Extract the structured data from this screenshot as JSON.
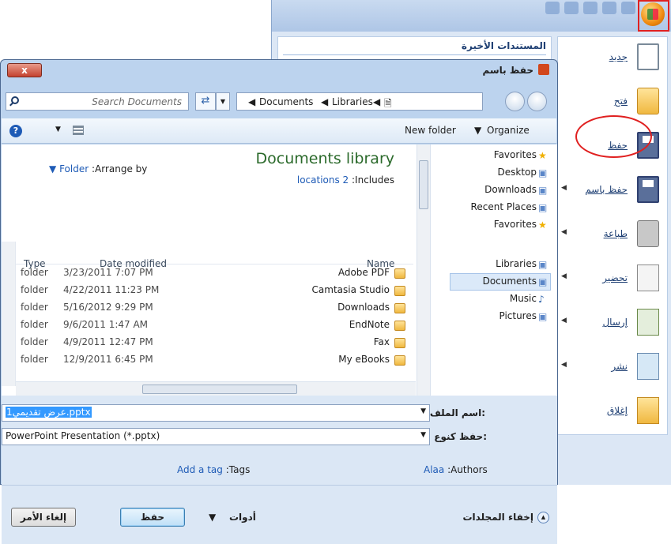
{
  "office": {
    "recent_title": "المستندات الأخيرة",
    "menu": [
      {
        "label": "جديد",
        "has_arrow": false
      },
      {
        "label": "فتح",
        "has_arrow": false
      },
      {
        "label": "حفظ",
        "has_arrow": false
      },
      {
        "label": "حفظ باسم",
        "has_arrow": true
      },
      {
        "label": "طباعة",
        "has_arrow": true
      },
      {
        "label": "تحضير",
        "has_arrow": true
      },
      {
        "label": "إرسال",
        "has_arrow": true
      },
      {
        "label": "نشر",
        "has_arrow": true
      },
      {
        "label": "إغلاق",
        "has_arrow": false
      }
    ]
  },
  "dialog": {
    "title": "حفظ باسم",
    "close": "x",
    "search_placeholder": "Search Documents",
    "breadcrumb": [
      "Libraries",
      "Documents"
    ],
    "toolbar": {
      "organize": "Organize",
      "new_folder": "New folder"
    },
    "library": {
      "title": "Documents library",
      "includes_label": ":Includes",
      "includes_link": "locations 2",
      "arrange_label": ":Arrange by",
      "arrange_link": "Folder"
    },
    "nav": [
      {
        "label": "Favorites",
        "icon": "star-icon"
      },
      {
        "label": "Desktop",
        "icon": "desktop-icon"
      },
      {
        "label": "Downloads",
        "icon": "folder-icon"
      },
      {
        "label": "Recent Places",
        "icon": "recent-places-icon"
      },
      {
        "label": "Favorites",
        "icon": "star-icon"
      },
      {
        "label": "Libraries",
        "icon": "libraries-icon"
      },
      {
        "label": "Documents",
        "icon": "document-icon",
        "selected": true
      },
      {
        "label": "Music",
        "icon": "music-icon"
      },
      {
        "label": "Pictures",
        "icon": "pictures-icon"
      }
    ],
    "columns": {
      "name": "Name",
      "date": "Date modified",
      "type": "Type"
    },
    "files": [
      {
        "name": "Adobe PDF",
        "date": "3/23/2011 7:07 PM",
        "type": "folder"
      },
      {
        "name": "Camtasia Studio",
        "date": "4/22/2011 11:23 PM",
        "type": "folder"
      },
      {
        "name": "Downloads",
        "date": "5/16/2012 9:29 PM",
        "type": "folder"
      },
      {
        "name": "EndNote",
        "date": "9/6/2011 1:47 AM",
        "type": "folder"
      },
      {
        "name": "Fax",
        "date": "4/9/2011 12:47 PM",
        "type": "folder"
      },
      {
        "name": "My eBooks",
        "date": "12/9/2011 6:45 PM",
        "type": "folder"
      }
    ],
    "filename_label": "اسم الملف:",
    "filename_value": "عرض تقديمي1.pptx",
    "filetype_label": "حفظ كنوع:",
    "filetype_value": "PowerPoint Presentation (*.pptx)",
    "authors_label": ":Authors",
    "authors_value": "Alaa",
    "tags_label": ":Tags",
    "tags_value": "Add a tag",
    "hide_folders": "إخفاء المجلدات",
    "tools": "أدوات",
    "save": "حفظ",
    "cancel": "إلغاء الأمر"
  }
}
